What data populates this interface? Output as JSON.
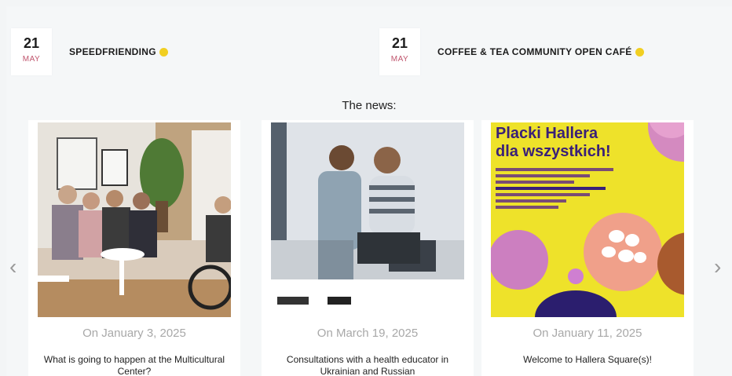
{
  "events": [
    {
      "day": "21",
      "month": "MAY",
      "title": "SPEEDFRIENDING"
    },
    {
      "day": "21",
      "month": "MAY",
      "title": "COFFEE & TEA COMMUNITY OPEN CAFÉ"
    }
  ],
  "news": {
    "heading": "The news:",
    "prev_arrow": "‹",
    "next_arrow": "›",
    "cards": [
      {
        "date": "On January 3, 2025",
        "title": "What is going to happen at the Multicultural Center?"
      },
      {
        "date": "On March 19, 2025",
        "title": "Consultations with a health educator in Ukrainian and Russian"
      },
      {
        "date": "On January 11, 2025",
        "title": "Welcome to Hallera Square(s)!"
      }
    ]
  },
  "card3_image": {
    "headline_line1": "Placki Hallera",
    "headline_line2": "dla wszystkich!"
  }
}
